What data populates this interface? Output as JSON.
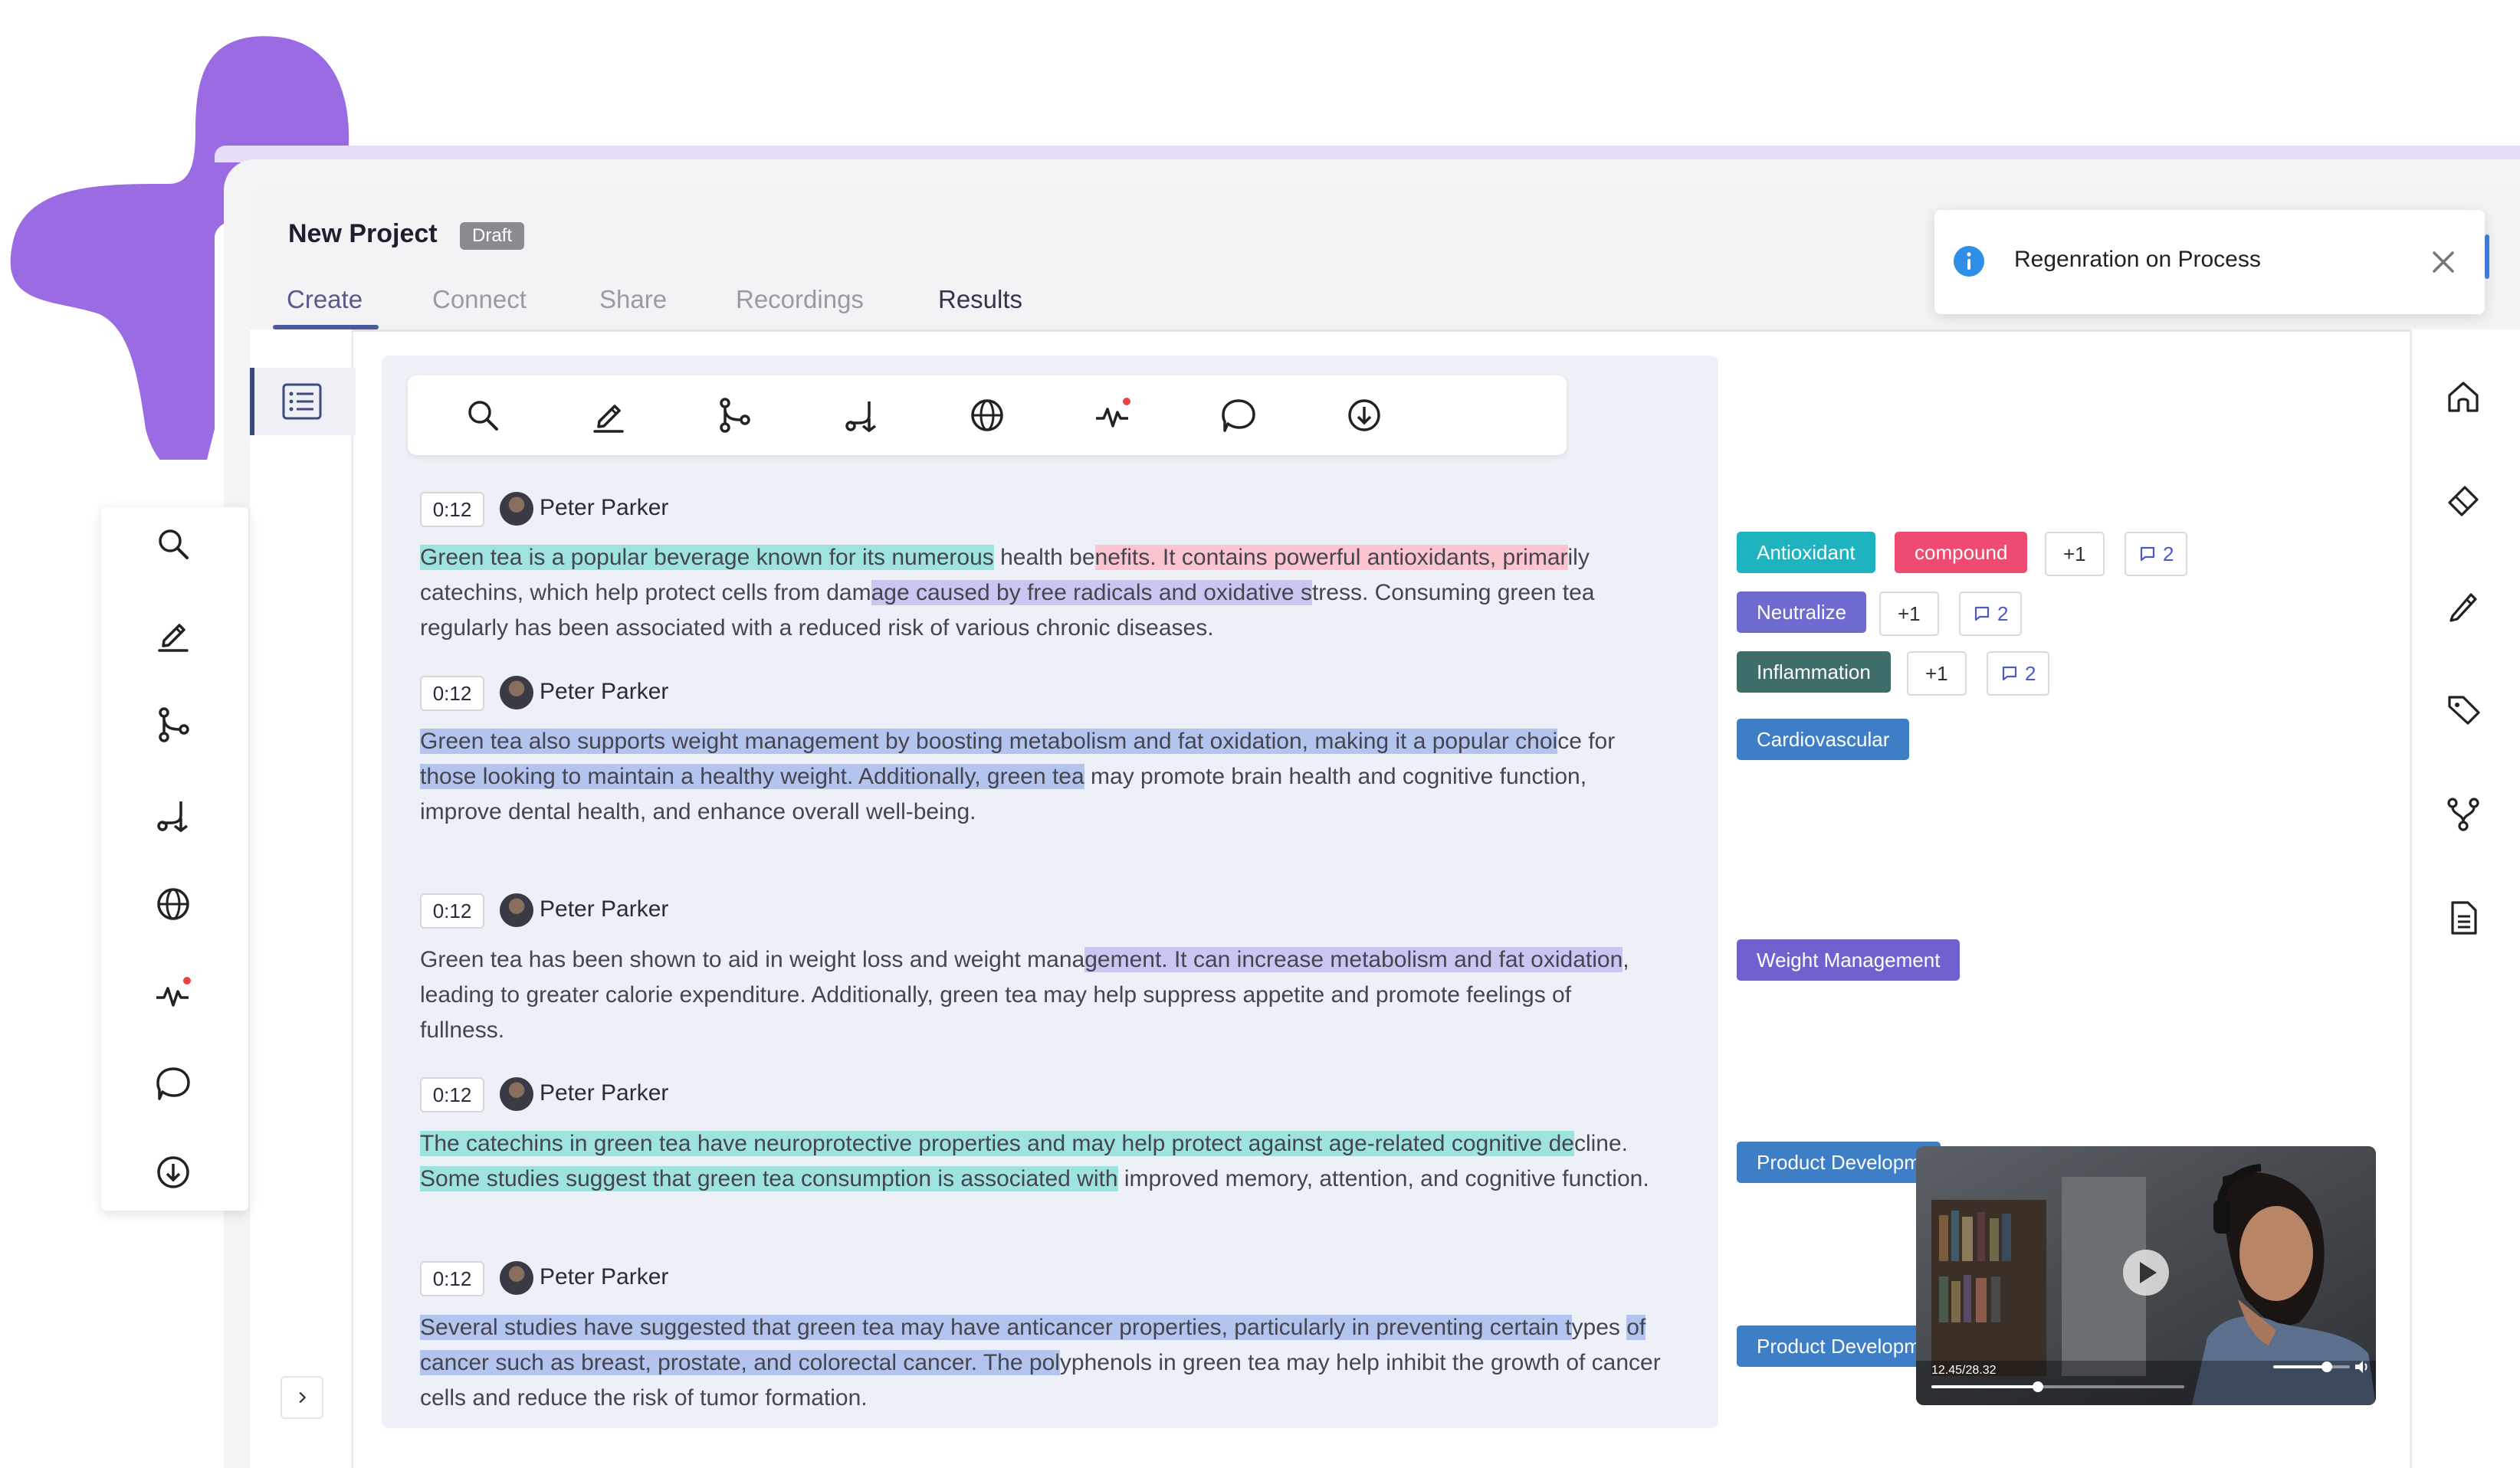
{
  "header": {
    "title": "New Project",
    "status_badge": "Draft",
    "tabs": [
      {
        "label": "Create"
      },
      {
        "label": "Connect"
      },
      {
        "label": "Share"
      },
      {
        "label": "Recordings"
      },
      {
        "label": "Results"
      }
    ]
  },
  "toolbar": {
    "icons": [
      "search-icon",
      "edit-icon",
      "branch-icon",
      "route-icon",
      "globe-icon",
      "activity-icon",
      "chat-icon",
      "download-icon"
    ]
  },
  "toast": {
    "message": "Regenration on Process",
    "icon": "info-icon",
    "accent": "#2f8fe8"
  },
  "transcript": [
    {
      "time": "0:12",
      "speaker": "Peter Parker",
      "segments": [
        {
          "text": "Green tea is a popular beverage known for its numerous",
          "hl": "teal"
        },
        {
          "text": " health be",
          "hl": ""
        },
        {
          "text": "nefits. It contains powerful antioxidants, primar",
          "hl": "pink"
        },
        {
          "text": "ily catechins, which help protect cells from dam",
          "hl": ""
        },
        {
          "text": "age caused by free radicals and oxidative s",
          "hl": "purple"
        },
        {
          "text": "tress. Consuming green tea regularly has been associated with a reduced risk of various chronic diseases.",
          "hl": ""
        }
      ]
    },
    {
      "time": "0:12",
      "speaker": "Peter Parker",
      "segments": [
        {
          "text": "Green tea also supports weight management by boosting metabolism and fat oxidation, making it a popular choi",
          "hl": "blue"
        },
        {
          "text": "ce for ",
          "hl": ""
        },
        {
          "text": "those looking to maintain a healthy weight. Additionally, green tea",
          "hl": "blue"
        },
        {
          "text": " may promote brain health and cognitive function, improve dental health, and enhance overall well-being.",
          "hl": ""
        }
      ]
    },
    {
      "time": "0:12",
      "speaker": "Peter Parker",
      "segments": [
        {
          "text": "Green tea has been shown to aid in weight loss and weight mana",
          "hl": ""
        },
        {
          "text": "gement. It can increase metabolism and fat oxidation",
          "hl": "purple"
        },
        {
          "text": ", leading to greater calorie expenditure. Additionally, green tea may help suppress appetite and promote feelings of fullness.",
          "hl": ""
        }
      ]
    },
    {
      "time": "0:12",
      "speaker": "Peter Parker",
      "segments": [
        {
          "text": "The catechins in green tea have neuroprotective properties and may help protect against age-related cognitive de",
          "hl": "teal"
        },
        {
          "text": "cline. ",
          "hl": ""
        },
        {
          "text": "Some studies suggest that green tea consumption is associated with",
          "hl": "teal"
        },
        {
          "text": " improved memory, attention, and cognitive function.",
          "hl": ""
        }
      ]
    },
    {
      "time": "0:12",
      "speaker": "Peter Parker",
      "segments": [
        {
          "text": "Several studies have suggested that green tea may have anticancer properties, particularly in preventing certain t",
          "hl": "blue"
        },
        {
          "text": "ypes ",
          "hl": ""
        },
        {
          "text": "of cancer such as breast, prostate, and colorectal cancer. The pol",
          "hl": "blue"
        },
        {
          "text": "yphenols in green tea may help inhibit the growth of cancer cells and reduce the risk of tumor formation.",
          "hl": ""
        }
      ]
    }
  ],
  "tags": {
    "row1": {
      "primary": "Antioxidant",
      "secondary": "compound",
      "more": "+1",
      "comments": "2"
    },
    "row2": {
      "primary": "Neutralize",
      "more": "+1",
      "comments": "2"
    },
    "row3": {
      "primary": "Inflammation",
      "more": "+1",
      "comments": "2"
    },
    "row4": {
      "primary": "Cardiovascular"
    },
    "row5": {
      "primary": "Weight Management"
    },
    "row6": {
      "primary": "Product Development"
    },
    "row7": {
      "primary": "Product Development"
    },
    "colors": {
      "teal": "#1fb3bf",
      "pink": "#ef4a72",
      "indigo": "#6f6ad0",
      "dark_teal": "#3f6e6a",
      "blue": "#3d7ec7",
      "purple": "#6f62cf"
    }
  },
  "video": {
    "time": "12.45/28.32",
    "progress": 0.42,
    "volume": 0.7
  },
  "right_rail": {
    "icons": [
      "home-icon",
      "eraser-icon",
      "pen-icon",
      "tag-icon",
      "branch-icon",
      "document-icon"
    ]
  }
}
